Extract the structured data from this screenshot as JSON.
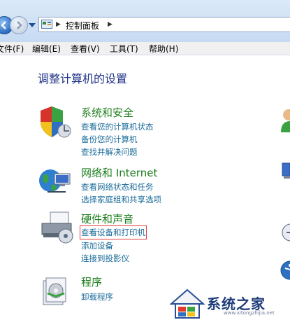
{
  "address_bar": {
    "path_label": "控制面板"
  },
  "menu": [
    {
      "label": "文件(F)"
    },
    {
      "label": "编辑(E)"
    },
    {
      "label": "查看(V)"
    },
    {
      "label": "工具(T)"
    },
    {
      "label": "帮助(H)"
    }
  ],
  "main": {
    "heading": "调整计算机的设置",
    "categories": [
      {
        "title": "系统和安全",
        "icon": "shield-icon",
        "links": [
          "查看您的计算机状态",
          "备份您的计算机",
          "查找并解决问题"
        ]
      },
      {
        "title": "网络和 Internet",
        "icon": "network-globe-icon",
        "links": [
          "查看网络状态和任务",
          "选择家庭组和共享选项"
        ]
      },
      {
        "title": "硬件和声音",
        "icon": "printer-icon",
        "links": [
          "查看设备和打印机",
          "添加设备",
          "连接到投影仪"
        ]
      },
      {
        "title": "程序",
        "icon": "programs-icon",
        "links": [
          "卸载程序"
        ]
      }
    ]
  },
  "watermark": {
    "brand": "系统之家",
    "url": "www.xitongzhijia.net"
  },
  "colors": {
    "heading": "#1e3287",
    "category_title": "#1e7f1e",
    "link": "#1a6b9a",
    "highlight_box": "#e04040"
  }
}
